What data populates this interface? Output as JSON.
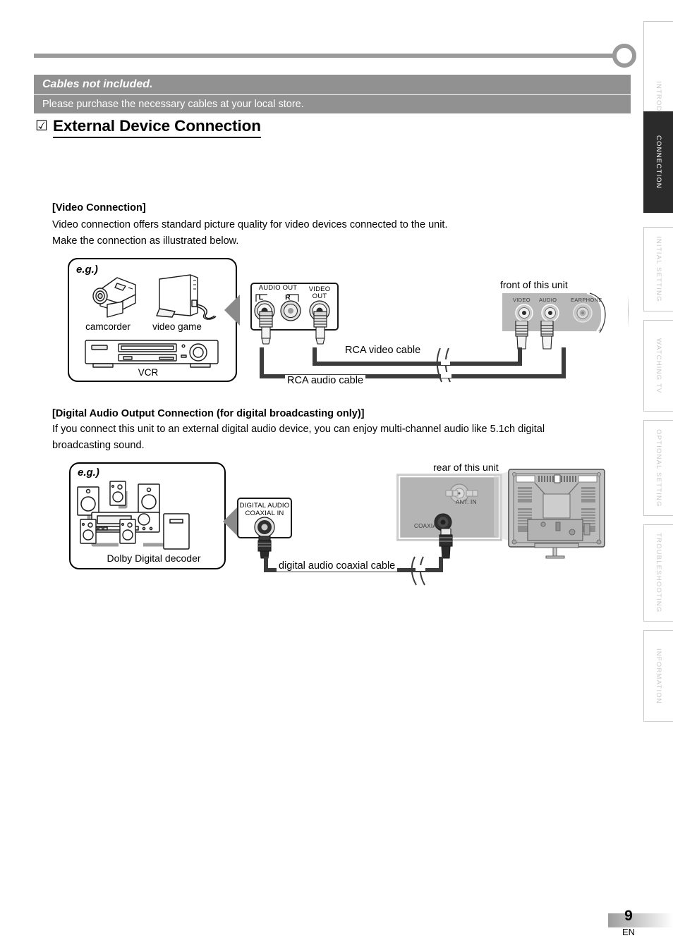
{
  "notice": {
    "title": "Cables not included.",
    "body": "Please purchase the necessary cables at your local store."
  },
  "heading": {
    "check_glyph": "☑",
    "title": "External Device Connection"
  },
  "sections": [
    {
      "heading": "[Video Connection]",
      "lines": [
        "Video connection offers standard picture quality for video devices connected to the unit.",
        "Make the connection as illustrated below."
      ],
      "example_label": "e.g.)",
      "devices": [
        "camcorder",
        "video game",
        "VCR"
      ],
      "source_panel": {
        "group_label": "AUDIO OUT",
        "jack_l": "L",
        "jack_r": "R",
        "video_label_1": "VIDEO",
        "video_label_2": "OUT"
      },
      "unit_label": "front of this unit",
      "unit_jacks": [
        "VIDEO",
        "AUDIO",
        "EARPHONE"
      ],
      "cables": [
        "RCA video cable",
        "RCA audio cable"
      ]
    },
    {
      "heading": "[Digital Audio Output Connection (for digital broadcasting only)]",
      "lines": [
        "If you connect this unit to an external digital audio device, you can enjoy multi-channel audio like 5.1ch digital",
        "broadcasting sound."
      ],
      "example_label": "e.g.)",
      "devices": [
        "Dolby Digital decoder"
      ],
      "source_panel": {
        "label_1": "DIGITAL AUDIO",
        "label_2": "COAXIAL IN"
      },
      "unit_label": "rear of this unit",
      "unit_jacks": [
        "ANT. IN",
        "COAXIAL"
      ],
      "cables": [
        "digital audio coaxial cable"
      ]
    }
  ],
  "sidebar": {
    "tabs": [
      {
        "label": "INTRODUCTION",
        "active": false
      },
      {
        "label": "CONNECTION",
        "active": true
      },
      {
        "label": "INITIAL  SETTING",
        "active": false
      },
      {
        "label": "WATCHING  TV",
        "active": false
      },
      {
        "label": "OPTIONAL  SETTING",
        "active": false
      },
      {
        "label": "TROUBLESHOOTING",
        "active": false
      },
      {
        "label": "INFORMATION",
        "active": false
      }
    ]
  },
  "footer": {
    "page_number": "9",
    "language": "EN"
  },
  "colors": {
    "notice_bar": "#919191",
    "rule": "#9a9a9a",
    "active_tab": "#2b2b2b",
    "cable": "#3c3c3c",
    "arrow": "#8a8a8a",
    "panel_gray": "#b4b4b4"
  }
}
